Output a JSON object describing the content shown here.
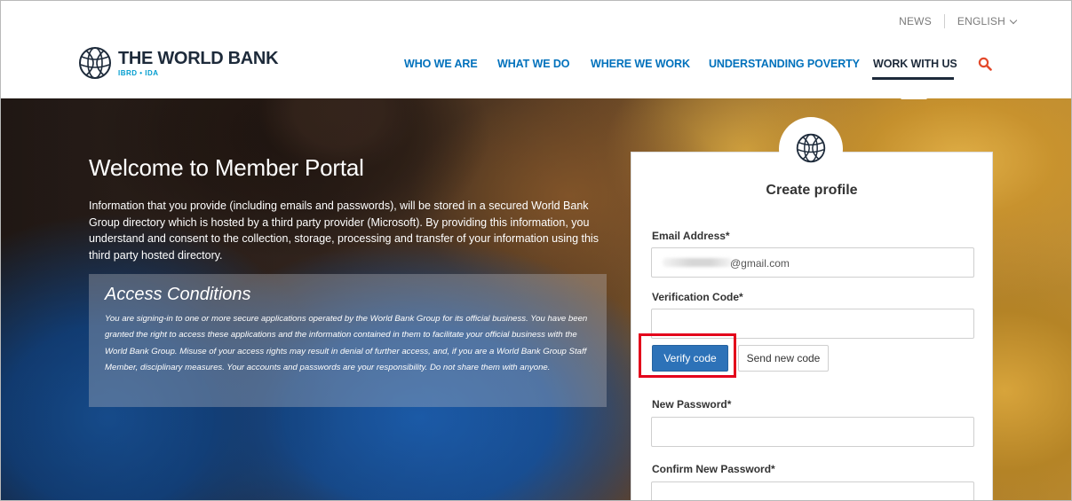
{
  "topbar": {
    "news": "NEWS",
    "language": "ENGLISH"
  },
  "logo": {
    "name": "THE WORLD BANK",
    "sub": "IBRD • IDA"
  },
  "nav": {
    "items": [
      {
        "label": "WHO WE ARE"
      },
      {
        "label": "WHAT WE DO"
      },
      {
        "label": "WHERE WE WORK"
      },
      {
        "label": "UNDERSTANDING POVERTY"
      },
      {
        "label": "WORK WITH US",
        "active": true
      }
    ]
  },
  "hero": {
    "title": "Welcome to Member Portal",
    "intro": "Information that you provide (including emails and passwords), will be stored in a secured World Bank Group directory which is hosted by a third party provider (Microsoft). By providing this information, you understand and consent to the collection, storage, processing and transfer of your information using this third party hosted directory.",
    "access": {
      "title": "Access Conditions",
      "text": "You are signing-in to one or more secure applications operated by the World Bank Group for its official business. You have been granted the right to access these applications and the information contained in them to facilitate your official business with the World Bank Group. Misuse of your access rights may result in denial of further access, and, if you are a World Bank Group Staff Member, disciplinary measures. Your accounts and passwords are your responsibility. Do not share them with anyone."
    }
  },
  "form": {
    "title": "Create profile",
    "email_label": "Email Address*",
    "email_value": "@gmail.com",
    "code_label": "Verification Code*",
    "code_value": "",
    "verify_button": "Verify code",
    "send_button": "Send new code",
    "new_password_label": "New Password*",
    "confirm_password_label": "Confirm New Password*"
  },
  "colors": {
    "nav_link": "#0071bc",
    "nav_active": "#1d2a3a",
    "search_icon": "#e3492b",
    "verify_button": "#2d72b8",
    "highlight": "#e3001b"
  }
}
